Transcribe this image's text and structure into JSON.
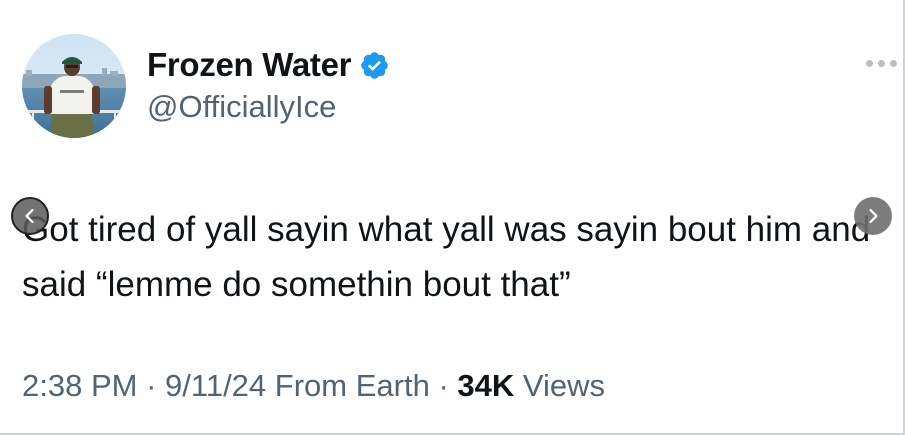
{
  "author": {
    "display_name": "Frozen Water",
    "handle": "@OfficiallyIce",
    "verified": true,
    "avatar_shirt_text": "EDUCATED"
  },
  "tweet": {
    "text": "Got tired of yall sayin what yall was sayin bout him and said “lemme do somethin bout that”"
  },
  "meta": {
    "time": "2:38 PM",
    "date": "9/11/24",
    "source": "From Earth",
    "views_count": "34K",
    "views_label": "Views",
    "separator": "·"
  },
  "icons": {
    "verified": "verified-badge-icon",
    "more": "more-options-icon",
    "prev": "chevron-left-icon",
    "next": "chevron-right-icon"
  },
  "colors": {
    "verified_blue": "#1d9bf0",
    "text_primary": "#0f1419",
    "text_secondary": "#536471"
  }
}
